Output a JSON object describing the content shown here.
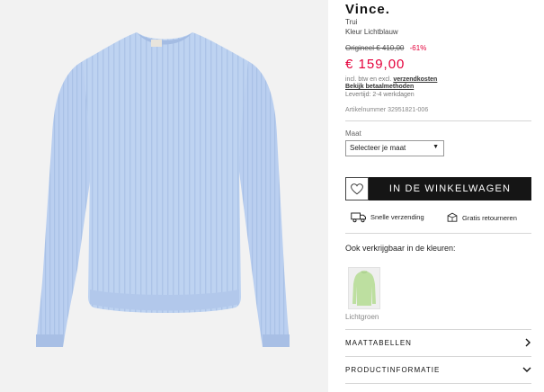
{
  "product": {
    "brand": "Vince.",
    "type": "Trui",
    "color": "Kleur Lichtblauw",
    "original_price": "Origineel € 410,00",
    "discount": "-61%",
    "price": "€ 159,00",
    "incl_text": "incl. btw en excl. ",
    "shipping_link": "verzendkosten",
    "payment_link": "Bekijk betaalmethoden",
    "delivery": "Levertijd: 2-4 werkdagen",
    "article_number": "Artikelnummer 32951821-006",
    "image_color": "#bcd1f0"
  },
  "size": {
    "label": "Maat",
    "selected": "Selecteer je maat"
  },
  "actions": {
    "cart_label": "IN DE WINKELWAGEN",
    "wishlist_icon": "heart-icon"
  },
  "usps": [
    {
      "icon": "truck-icon",
      "label": "Snelle verzending"
    },
    {
      "icon": "return-box-icon",
      "label": "Gratis retourneren"
    }
  ],
  "variants": {
    "heading": "Ook verkrijgbaar in de kleuren:",
    "items": [
      {
        "label": "Lichtgroen",
        "color": "#bddfa0"
      }
    ]
  },
  "accordion": [
    {
      "label": "MAATTABELLEN",
      "icon": "chevron-right-icon"
    },
    {
      "label": "PRODUCTINFORMATIE",
      "icon": "chevron-down-icon"
    }
  ],
  "colors": {
    "accent_red": "#e4003b",
    "button_dark": "#151515"
  }
}
